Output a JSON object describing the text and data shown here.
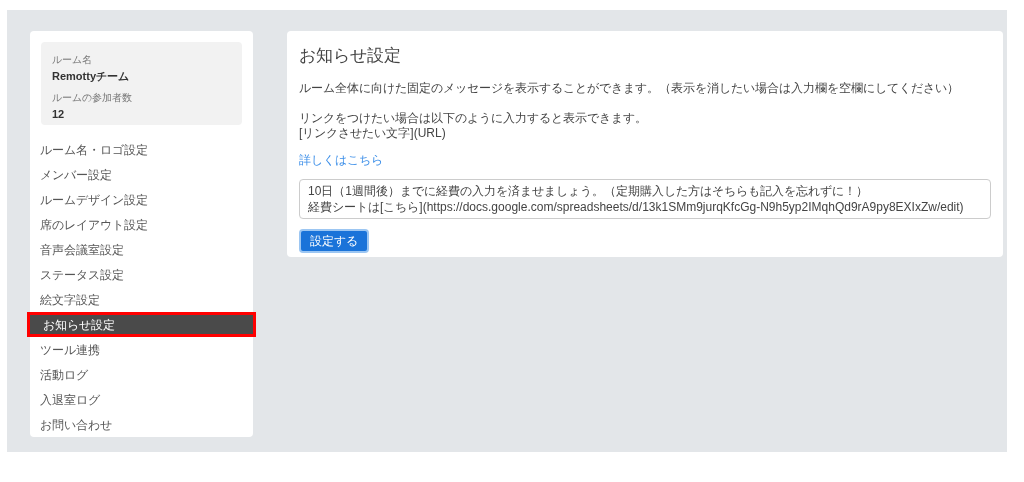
{
  "room_info": {
    "name_label": "ルーム名",
    "name": "Remottyチーム",
    "members_label": "ルームの参加者数",
    "members": "12"
  },
  "sidebar": {
    "items": [
      {
        "label": "ルーム名・ロゴ設定",
        "selected": false
      },
      {
        "label": "メンバー設定",
        "selected": false
      },
      {
        "label": "ルームデザイン設定",
        "selected": false
      },
      {
        "label": "席のレイアウト設定",
        "selected": false
      },
      {
        "label": "音声会議室設定",
        "selected": false
      },
      {
        "label": "ステータス設定",
        "selected": false
      },
      {
        "label": "絵文字設定",
        "selected": false
      },
      {
        "label": "お知らせ設定",
        "selected": true
      },
      {
        "label": "ツール連携",
        "selected": false
      },
      {
        "label": "活動ログ",
        "selected": false
      },
      {
        "label": "入退室ログ",
        "selected": false
      },
      {
        "label": "お問い合わせ",
        "selected": false
      }
    ]
  },
  "main": {
    "title": "お知らせ設定",
    "description": "ルーム全体に向けた固定のメッセージを表示することができます。（表示を消したい場合は入力欄を空欄にしてください）",
    "link_help": [
      "リンクをつけたい場合は以下のように入力すると表示できます。",
      "[リンクさせたい文字](URL)"
    ],
    "details_link": "詳しくはこちら",
    "message_lines": [
      "10日（1週間後）までに経費の入力を済ませましょう。（定期購入した方はそちらも記入を忘れずに！）",
      "経費シートは[こちら](https://docs.google.com/spreadsheets/d/13k1SMm9jurqKfcGg-N9h5yp2IMqhQd9rA9py8EXIxZw/edit)"
    ],
    "submit": "設定する"
  }
}
